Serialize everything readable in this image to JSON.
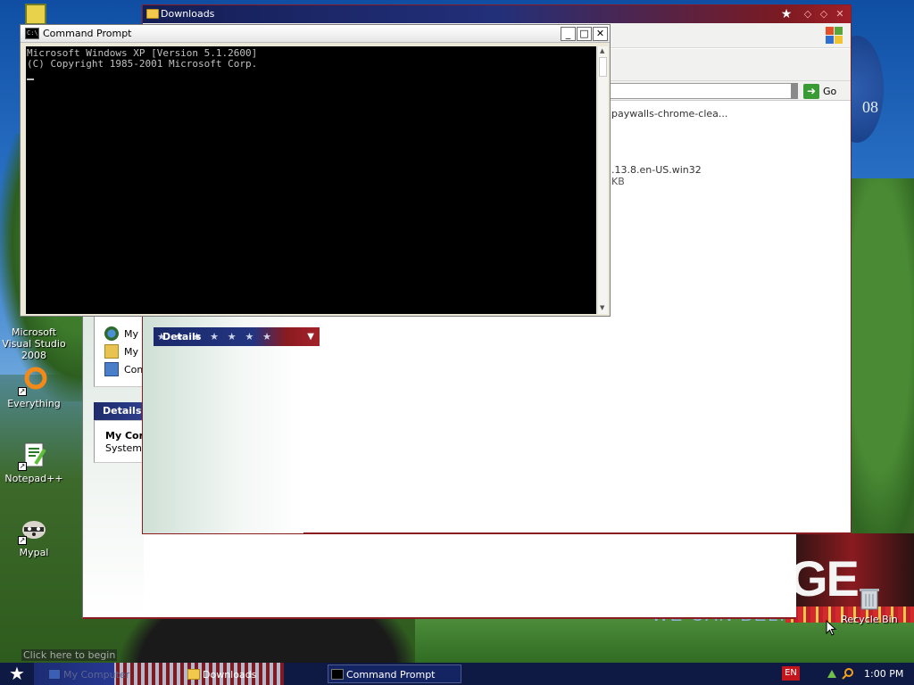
{
  "desktop": {
    "icons": [
      {
        "label": "Microsoft Visual Studio 2008"
      },
      {
        "label": "Everything"
      },
      {
        "label": "Notepad++"
      },
      {
        "label": "Mypal"
      },
      {
        "label": "Recycle Bin"
      }
    ],
    "wallpaper_fragments": {
      "slogan_big": "GE",
      "slogan_small": "WE CAN BELIEVE IN",
      "disc_text": "08"
    }
  },
  "my_computer_window": {
    "links": [
      "My N",
      "My D",
      "Com"
    ],
    "details_header": "Details",
    "details_title": "My Con",
    "details_sub": "System F"
  },
  "downloads_window": {
    "title": "Downloads",
    "go_label": "Go",
    "files": [
      {
        "name": "paywalls-chrome-clea..."
      },
      {
        "name": ".13.8.en-US.win32",
        "sub": "KB"
      }
    ],
    "details_header": "Details"
  },
  "command_prompt": {
    "title": "Command Prompt",
    "lines": [
      "Microsoft Windows XP [Version 5.1.2600]",
      "(C) Copyright 1985-2001 Microsoft Corp."
    ]
  },
  "taskbar": {
    "tooltip": "Click here to begin",
    "tasks": [
      {
        "label": "My Computer"
      },
      {
        "label": "Downloads"
      },
      {
        "label": "Command Prompt"
      }
    ],
    "language": "EN",
    "clock": "1:00 PM"
  },
  "colors": {
    "accent_blue": "#1b2a6b",
    "accent_red": "#8a1b20",
    "taskbar": "#0e1a44"
  }
}
